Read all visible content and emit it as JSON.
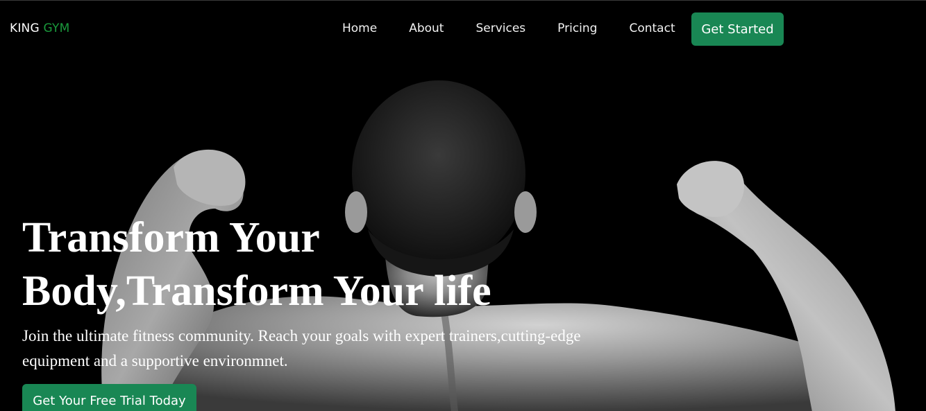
{
  "brand": {
    "name_part1": "KING",
    "name_part2": "GYM",
    "accent_color": "#1a9a3c"
  },
  "nav": {
    "items": [
      {
        "label": "Home"
      },
      {
        "label": "About"
      },
      {
        "label": "Services"
      },
      {
        "label": "Pricing"
      },
      {
        "label": "Contact"
      }
    ],
    "cta_label": "Get Started",
    "cta_color": "#198754"
  },
  "hero": {
    "title_line1": "Transform Your",
    "title_line2": "Body,Transform Your life",
    "subtitle": "Join the ultimate fitness community. Reach your goals with expert trainers,cutting-edge equipment and a supportive environmnet.",
    "cta_label": "Get Your Free Trial Today",
    "background_image": "muscular-man-back-flexing"
  }
}
